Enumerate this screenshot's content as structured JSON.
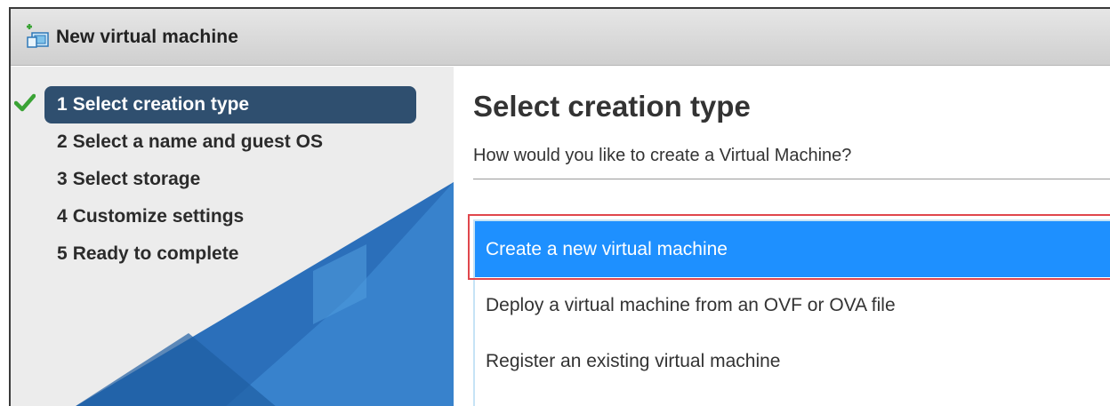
{
  "window": {
    "title": "New virtual machine",
    "icon": "new-vm-icon"
  },
  "wizard": {
    "steps": [
      {
        "number": "1",
        "label": "Select creation type",
        "active": true,
        "completed": true
      },
      {
        "number": "2",
        "label": "Select a name and guest OS",
        "active": false,
        "completed": false
      },
      {
        "number": "3",
        "label": "Select storage",
        "active": false,
        "completed": false
      },
      {
        "number": "4",
        "label": "Customize settings",
        "active": false,
        "completed": false
      },
      {
        "number": "5",
        "label": "Ready to complete",
        "active": false,
        "completed": false
      }
    ]
  },
  "main": {
    "title": "Select creation type",
    "subtitle": "How would you like to create a Virtual Machine?",
    "options": [
      {
        "label": "Create a new virtual machine",
        "selected": true
      },
      {
        "label": "Deploy a virtual machine from an OVF or OVA file",
        "selected": false
      },
      {
        "label": "Register an existing virtual machine",
        "selected": false
      }
    ]
  },
  "colors": {
    "active_step": "#2f4f6f",
    "selected_option": "#1e90ff",
    "highlight_frame": "#e0474c",
    "check": "#3aa335",
    "sidebar_accent": "#1f6fc0"
  }
}
